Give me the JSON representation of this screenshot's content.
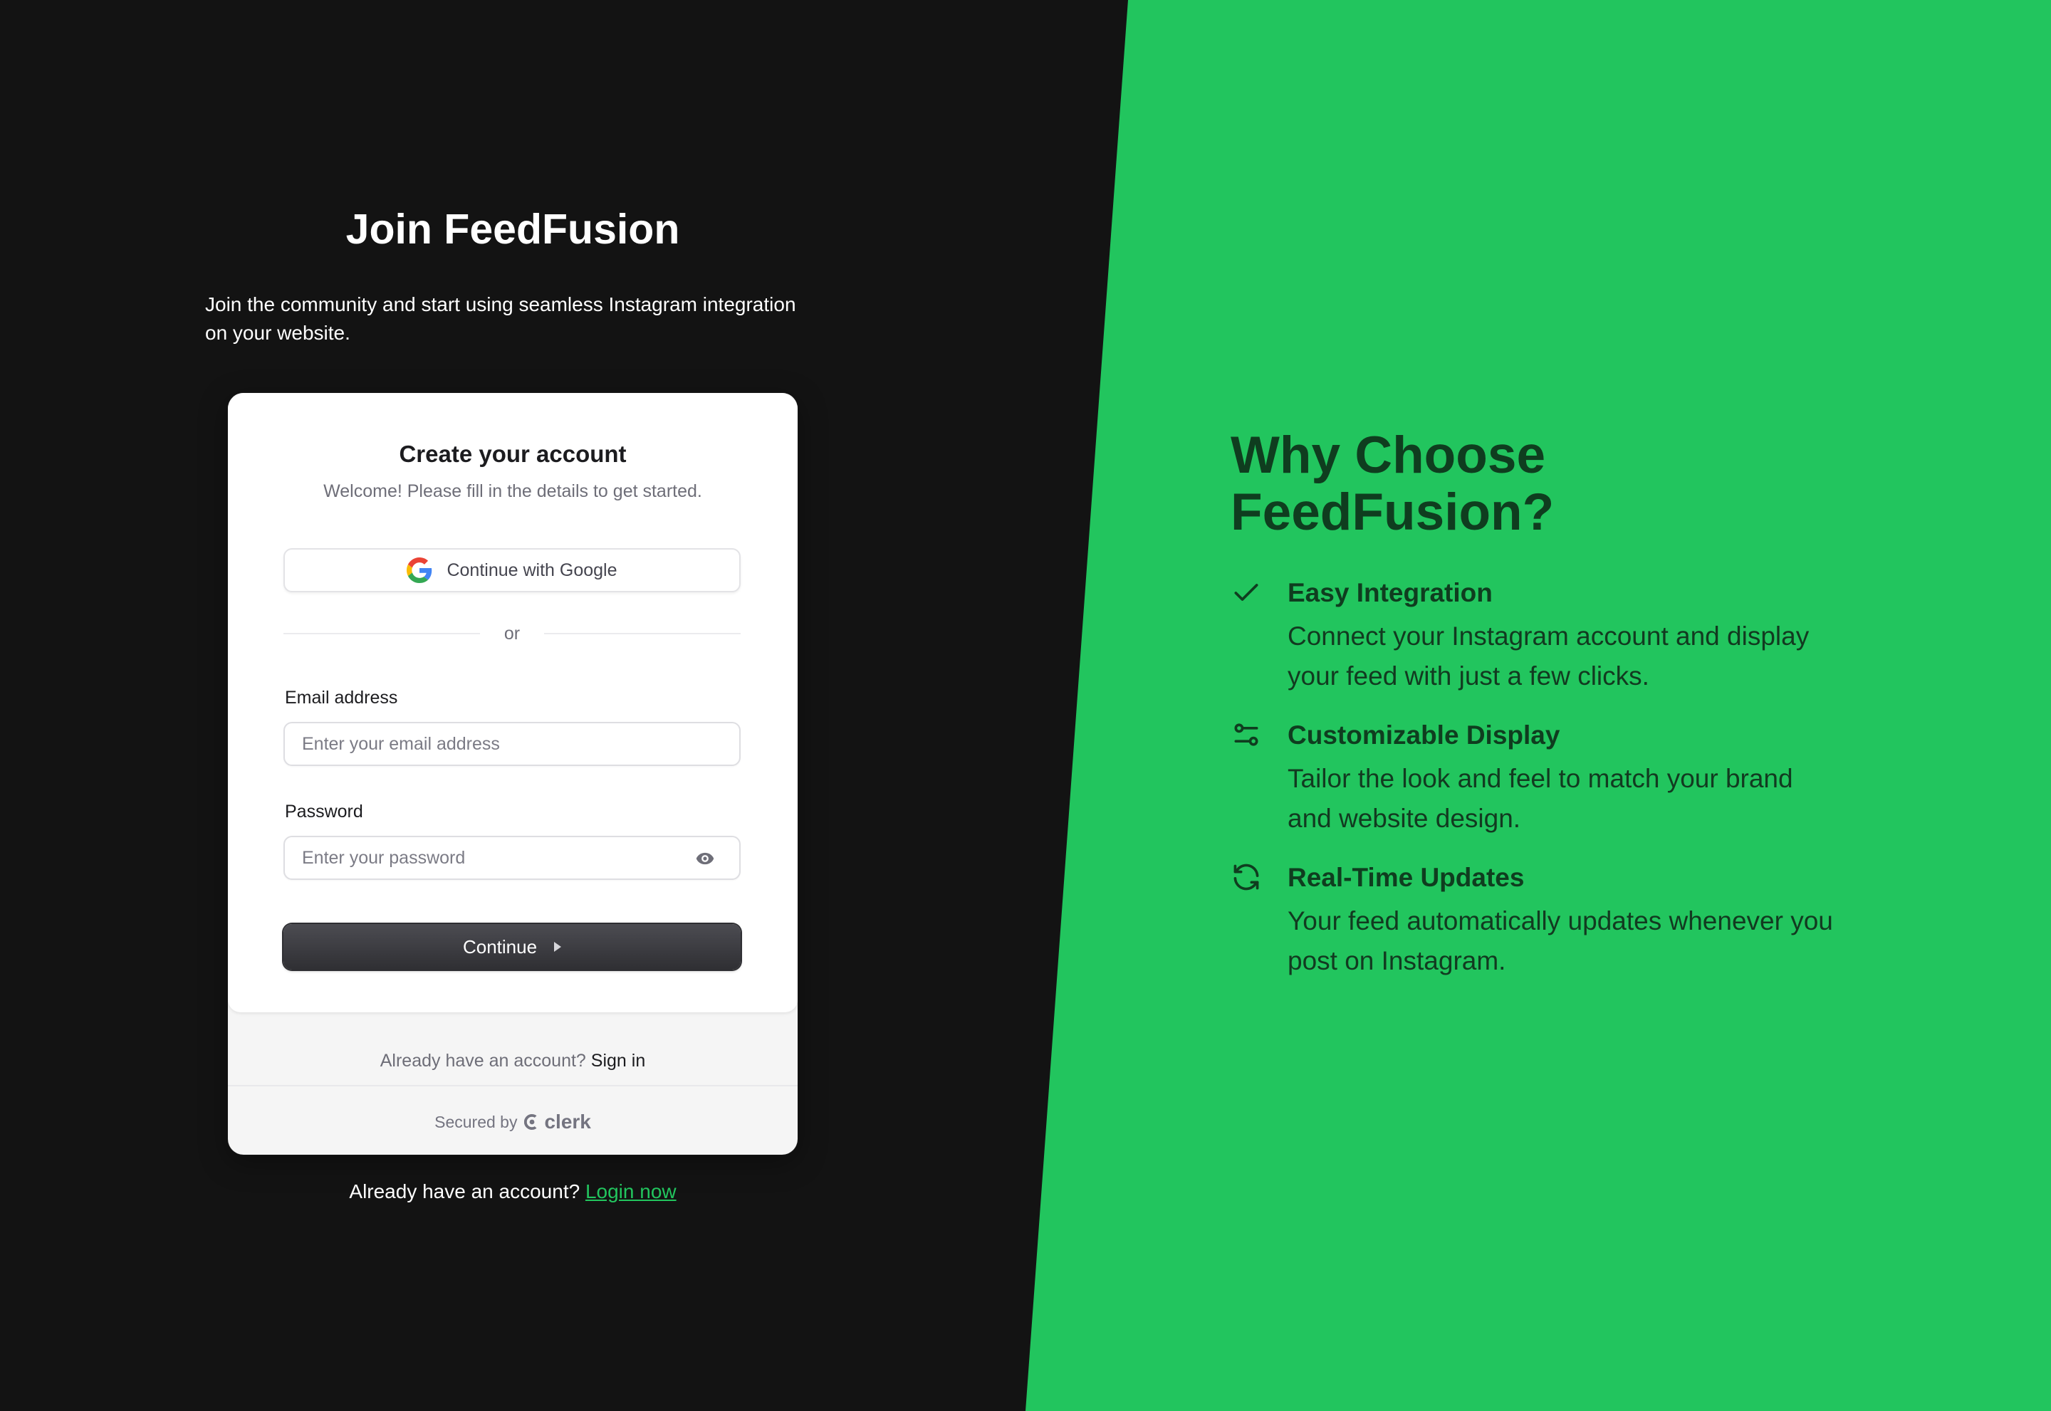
{
  "colors": {
    "background_dark": "#131313",
    "accent_green": "#22c55e",
    "heading_dark_green": "#0f3d1f"
  },
  "left": {
    "title": "Join FeedFusion",
    "subtitle": "Join the community and start using seamless Instagram integration on your website."
  },
  "card": {
    "title": "Create your account",
    "subtitle": "Welcome! Please fill in the details to get started.",
    "google_button": {
      "label": "Continue with Google",
      "icon": "google-icon"
    },
    "divider_text": "or",
    "email": {
      "label": "Email address",
      "placeholder": "Enter your email address",
      "value": ""
    },
    "password": {
      "label": "Password",
      "placeholder": "Enter your password",
      "value": "",
      "toggle_icon": "eye-icon"
    },
    "continue_button": {
      "label": "Continue",
      "icon": "triangle-right-icon"
    },
    "footer": {
      "prompt": "Already have an account?",
      "link": "Sign in"
    },
    "secured": {
      "prefix": "Secured by",
      "brand": "clerk"
    }
  },
  "below_card": {
    "prompt": "Already have an account?",
    "link": "Login now"
  },
  "right": {
    "title": "Why Choose FeedFusion?",
    "features": [
      {
        "icon": "checkmark-icon",
        "title": "Easy Integration",
        "description": "Connect your Instagram account and display your feed with just a few clicks."
      },
      {
        "icon": "sliders-icon",
        "title": "Customizable Display",
        "description": "Tailor the look and feel to match your brand and website design."
      },
      {
        "icon": "refresh-icon",
        "title": "Real-Time Updates",
        "description": "Your feed automatically updates whenever you post on Instagram."
      }
    ]
  }
}
